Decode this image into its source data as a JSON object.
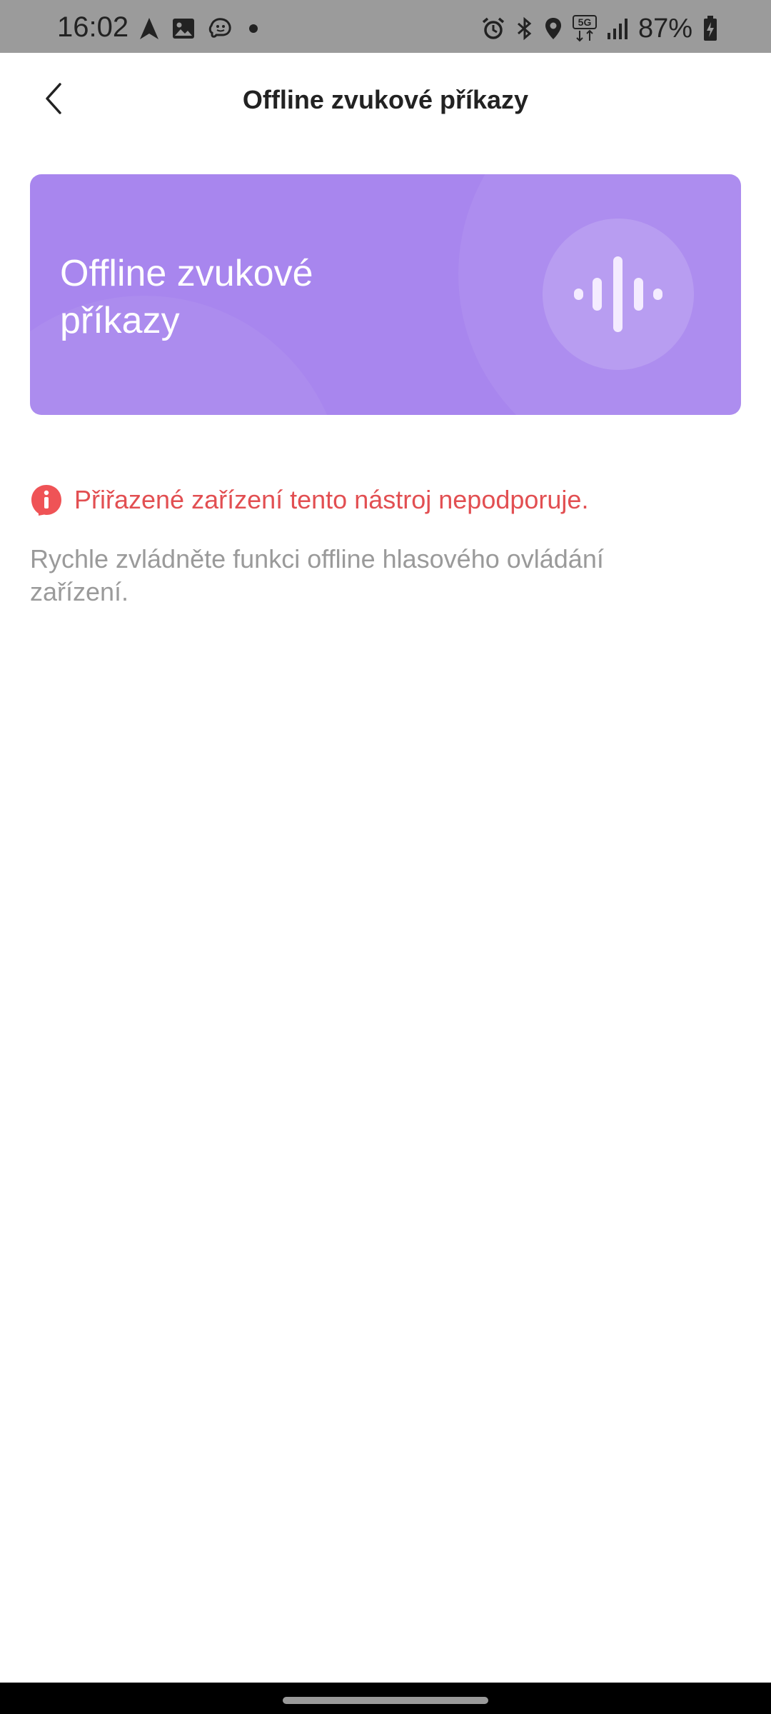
{
  "status_bar": {
    "time": "16:02",
    "battery_percent": "87%",
    "network": "5G",
    "left_icons": [
      "navigation-arrow-icon",
      "gallery-icon",
      "waze-icon",
      "notification-dot-icon"
    ],
    "right_icons": [
      "alarm-icon",
      "bluetooth-icon",
      "location-pin-icon",
      "5g-data-icon",
      "signal-bars-icon",
      "battery-charging-icon"
    ]
  },
  "header": {
    "back_icon": "chevron-left-icon",
    "title": "Offline zvukové příkazy"
  },
  "banner": {
    "title": "Offline zvukové příkazy",
    "icon": "voice-waveform-icon",
    "background_color": "#a886ee"
  },
  "warning": {
    "icon": "info-alert-icon",
    "text": "Přiřazené zařízení tento nástroj nepodporuje.",
    "color": "#e24f52"
  },
  "description": "Rychle zvládněte funkci offline hlasového ovládání zařízení.",
  "navigation": {
    "home_indicator": "home-pill"
  }
}
